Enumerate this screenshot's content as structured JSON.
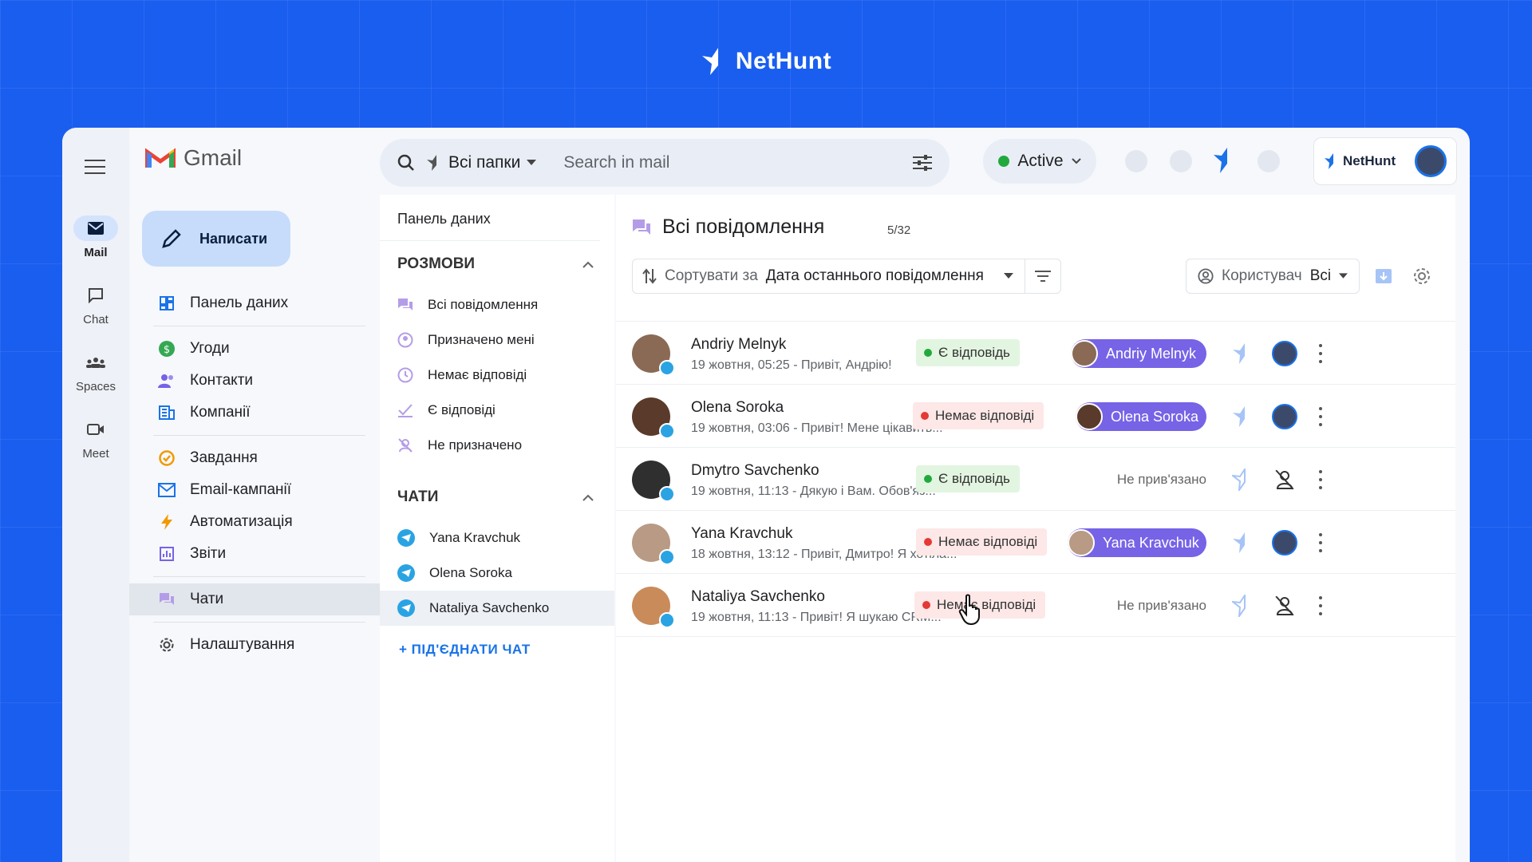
{
  "brand": {
    "name": "NetHunt"
  },
  "rail": [
    {
      "label": "Mail",
      "icon": "mail-icon",
      "active": true
    },
    {
      "label": "Chat",
      "icon": "chat-icon"
    },
    {
      "label": "Spaces",
      "icon": "spaces-icon"
    },
    {
      "label": "Meet",
      "icon": "meet-icon"
    }
  ],
  "gmail": {
    "title": "Gmail"
  },
  "search": {
    "folders": "Всі папки",
    "placeholder": "Search in mail"
  },
  "status": {
    "label": "Active",
    "color": "#22a93d"
  },
  "badge": {
    "label": "NetHunt"
  },
  "compose": {
    "label": "Написати"
  },
  "nav": {
    "dashboard": "Панель даних",
    "deals": "Угоди",
    "contacts": "Контакти",
    "companies": "Компанії",
    "tasks": "Завдання",
    "campaigns": "Email-кампанії",
    "automation": "Автоматизація",
    "reports": "Звіти",
    "chats": "Чати",
    "settings": "Налаштування"
  },
  "mid": {
    "title": "Панель даних",
    "conversations_header": "РОЗМОВИ",
    "conversations": [
      "Всі повідомлення",
      "Призначено мені",
      "Немає відповіді",
      "Є відповіді",
      "Не призначено"
    ],
    "chats_header": "ЧАТИ",
    "chats": [
      "Yana Kravchuk",
      "Olena Soroka",
      "Nataliya Savchenko"
    ],
    "connect": "ПІД'ЄДНАТИ ЧАТ"
  },
  "main": {
    "title": "Всі повідомлення",
    "count": "5/32",
    "sort_label": "Сортувати за",
    "sort_value": "Дата останнього повідомлення",
    "user_label": "Користувач",
    "user_value": "Всі",
    "rows": [
      {
        "name": "Andriy Melnyk",
        "sub": "19 жовтня, 05:25 - Привіт, Андрію!",
        "status": "Є відповідь",
        "status_type": "ok",
        "assignee": "Andriy Melnyk",
        "avatar_color": "#8a6a55"
      },
      {
        "name": "Olena Soroka",
        "sub": "19 жовтня, 03:06 - Привіт! Мене цікавить...",
        "status": "Немає відповіді",
        "status_type": "no",
        "assignee": "Olena Soroka",
        "avatar_color": "#5a3a2a"
      },
      {
        "name": "Dmytro Savchenko",
        "sub": "19 жовтня, 11:13 - Дякую і Вам. Обов'яз...",
        "status": "Є відповідь",
        "status_type": "ok",
        "assignee": "",
        "unlinked": "Не прив'язано",
        "avatar_color": "#2f2f2f"
      },
      {
        "name": "Yana Kravchuk",
        "sub": "18 жовтня, 13:12 - Привіт, Дмитро! Я хотіла...",
        "status": "Немає відповіді",
        "status_type": "no",
        "assignee": "Yana Kravchuk",
        "avatar_color": "#b89a85"
      },
      {
        "name": "Nataliya Savchenko",
        "sub": "19 жовтня, 11:13 - Привіт! Я шукаю CRM...",
        "status": "Немає відповіді",
        "status_type": "no",
        "assignee": "",
        "unlinked": "Не прив'язано",
        "avatar_color": "#c98b5a"
      }
    ]
  },
  "colors": {
    "accent": "#1a5ef0",
    "pill": "#7663e6",
    "ok": "#22a93d",
    "no": "#e53935",
    "telegram": "#2aa3e3"
  }
}
